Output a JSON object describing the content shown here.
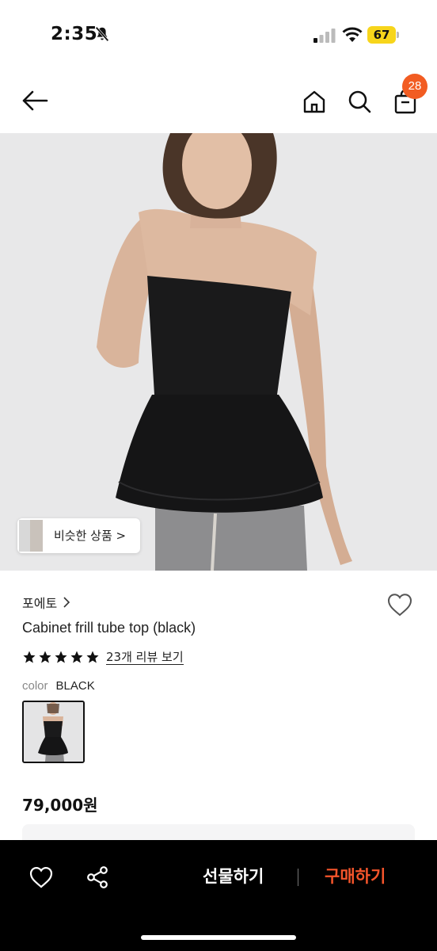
{
  "status_bar": {
    "time": "2:35",
    "battery": "67",
    "battery_color": "#f7d51b"
  },
  "header": {
    "icons": [
      "back-arrow-icon",
      "home-icon",
      "search-icon",
      "shopping-bag-icon"
    ],
    "cart_badge": "28",
    "badge_color": "#f25c22"
  },
  "image": {
    "similar_label": "비슷한 상품 >"
  },
  "product": {
    "brand": "포에토",
    "title": "Cabinet frill tube top (black)",
    "rating_stars": 5,
    "review_link": "23개 리뷰 보기",
    "color_label": "color",
    "color_value": "BLACK",
    "price": "79,000원"
  },
  "bottom_bar": {
    "gift_label": "선물하기",
    "buy_label": "구매하기",
    "buy_color": "#f5552b"
  }
}
